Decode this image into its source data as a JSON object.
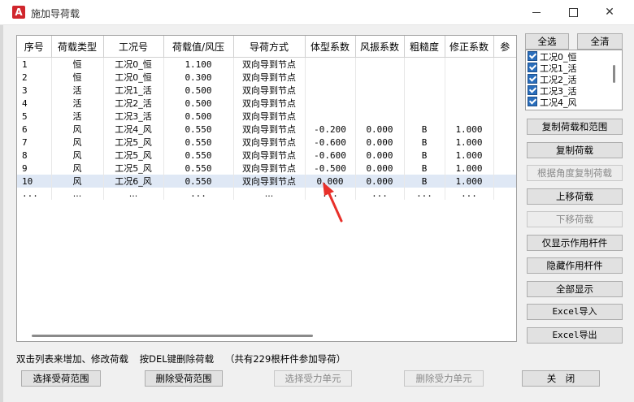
{
  "window": {
    "title": "施加导荷载",
    "app_icon_letter": "A"
  },
  "table": {
    "columns": [
      "序号",
      "荷载类型",
      "工况号",
      "荷载值/风压",
      "导荷方式",
      "体型系数",
      "风振系数",
      "粗糙度",
      "修正系数",
      "参"
    ],
    "rows": [
      [
        "1",
        "恒",
        "工况0_恒",
        "1.100",
        "双向导到节点",
        "",
        "",
        "",
        ""
      ],
      [
        "2",
        "恒",
        "工况0_恒",
        "0.300",
        "双向导到节点",
        "",
        "",
        "",
        ""
      ],
      [
        "3",
        "活",
        "工况1_活",
        "0.500",
        "双向导到节点",
        "",
        "",
        "",
        ""
      ],
      [
        "4",
        "活",
        "工况2_活",
        "0.500",
        "双向导到节点",
        "",
        "",
        "",
        ""
      ],
      [
        "5",
        "活",
        "工况3_活",
        "0.500",
        "双向导到节点",
        "",
        "",
        "",
        ""
      ],
      [
        "6",
        "风",
        "工况4_风",
        "0.550",
        "双向导到节点",
        "-0.200",
        "0.000",
        "B",
        "1.000"
      ],
      [
        "7",
        "风",
        "工况5_风",
        "0.550",
        "双向导到节点",
        "-0.600",
        "0.000",
        "B",
        "1.000"
      ],
      [
        "8",
        "风",
        "工况5_风",
        "0.550",
        "双向导到节点",
        "-0.600",
        "0.000",
        "B",
        "1.000"
      ],
      [
        "9",
        "风",
        "工况5_风",
        "0.550",
        "双向导到节点",
        "-0.500",
        "0.000",
        "B",
        "1.000"
      ],
      [
        "10",
        "风",
        "工况6_风",
        "0.550",
        "双向导到节点",
        "0.000",
        "0.000",
        "B",
        "1.000"
      ],
      [
        "...",
        "...",
        "...",
        "...",
        "...",
        "...",
        "...",
        "...",
        "..."
      ]
    ],
    "selected_row": 10
  },
  "sidebar": {
    "select_all": "全选",
    "clear_all": "全清",
    "cases": [
      "工况0_恒",
      "工况1_活",
      "工况2_活",
      "工况3_活",
      "工况4_风"
    ],
    "buttons": {
      "copy_load_range": "复制荷载和范围",
      "copy_load": "复制荷载",
      "copy_by_angle": "根据角度复制荷载",
      "move_up": "上移荷载",
      "move_down": "下移荷载",
      "show_active_only": "仅显示作用杆件",
      "hide_active": "隐藏作用杆件",
      "show_all": "全部显示",
      "excel_import": "Excel导入",
      "excel_export": "Excel导出"
    }
  },
  "status": {
    "hint_edit": "双击列表来增加、修改荷载",
    "hint_delete": "按DEL键删除荷载",
    "member_count": "（共有229根杆件参加导荷）"
  },
  "footer": {
    "select_range": "选择受荷范围",
    "delete_range": "删除受荷范围",
    "select_element": "选择受力单元",
    "delete_element": "删除受力单元",
    "close": "关　闭"
  },
  "colors": {
    "accent": "#2a6ebc",
    "arrow": "#e8302a",
    "selected_row": "#dfe8f5"
  },
  "icons": {
    "app": "autocad-icon",
    "minimize": "minimize-icon",
    "maximize": "maximize-icon",
    "close": "close-icon"
  }
}
